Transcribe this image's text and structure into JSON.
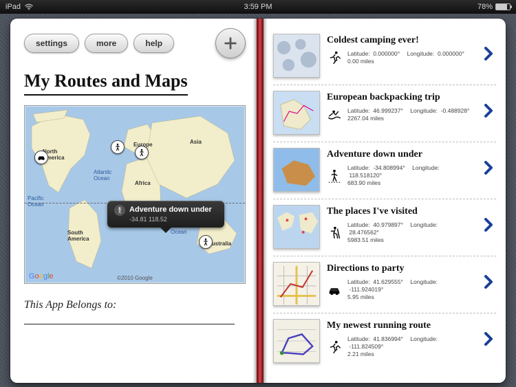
{
  "status": {
    "device": "iPad",
    "time": "3:59 PM",
    "battery_pct": "78%"
  },
  "toolbar": {
    "settings": "settings",
    "more": "more",
    "help": "help"
  },
  "title": "My Routes and Maps",
  "map": {
    "labels": {
      "north_america": "North\nAmerica",
      "south_america": "South\nAmerica",
      "europe": "Europe",
      "africa": "Africa",
      "asia": "Asia",
      "australia": "Australia",
      "atlantic": "Atlantic\nOcean",
      "pacific": "Pacific\nOcean",
      "indian": "Indian\nOcean"
    },
    "callout": {
      "title": "Adventure down under",
      "sub": "-34.81   118.52"
    },
    "attribution": "©2010 Google"
  },
  "belongs_label": "This App Belongs to:",
  "routes": [
    {
      "title": "Coldest camping ever!",
      "activity": "run",
      "lat": "0.000000°",
      "lon": "0.000000°",
      "miles": "0.00 miles",
      "thumb": "ice"
    },
    {
      "title": "European backpacking trip",
      "activity": "row",
      "lat": "46.999237°",
      "lon": "-0.488928°",
      "miles": "2267.04 miles",
      "thumb": "europe"
    },
    {
      "title": "Adventure down under",
      "activity": "walk",
      "lat": "-34.808994°",
      "lon": "118.518120°",
      "miles": "683.90 miles",
      "thumb": "australia"
    },
    {
      "title": "The places I've visited",
      "activity": "hike",
      "lat": "40.979897°",
      "lon": "28.476562°",
      "miles": "5983.51 miles",
      "thumb": "world"
    },
    {
      "title": "Directions to party",
      "activity": "car",
      "lat": "41.629555°",
      "lon": "-111.924019°",
      "miles": "5.95 miles",
      "thumb": "roads"
    },
    {
      "title": "My newest running route",
      "activity": "run",
      "lat": "41.836994°",
      "lon": "-111.824509°",
      "miles": "2.21 miles",
      "thumb": "route"
    }
  ],
  "labels": {
    "lat": "Latitude:",
    "lon": "Longitude:"
  }
}
